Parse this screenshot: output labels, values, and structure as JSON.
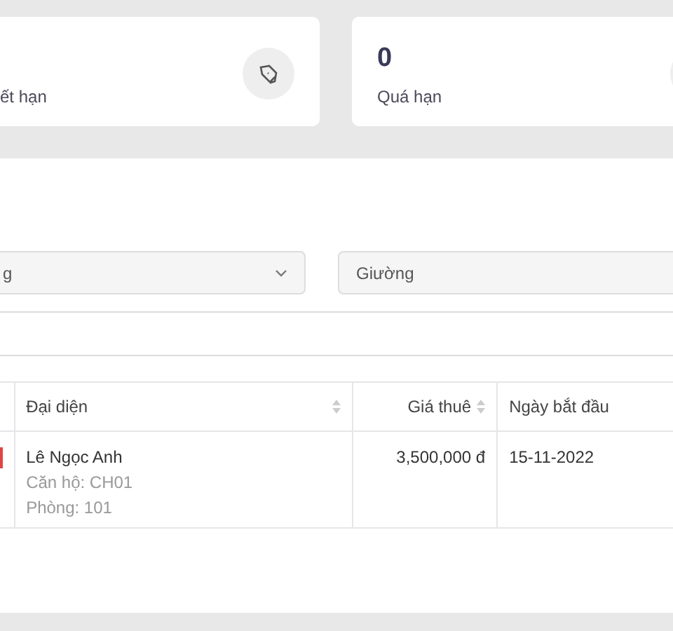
{
  "stats": [
    {
      "label": "ết hạn"
    },
    {
      "value": "0",
      "label": "Quá hạn"
    }
  ],
  "filters": [
    {
      "kind": "select",
      "value": "g"
    },
    {
      "kind": "input",
      "placeholder": "Giường"
    }
  ],
  "table": {
    "columns": [
      {
        "label": "Đại diện",
        "sortable": true
      },
      {
        "label": "Giá thuê",
        "sortable": true
      },
      {
        "label": "Ngày bắt đầu",
        "sortable": false
      }
    ],
    "rows": [
      {
        "representative": "Lê Ngọc Anh",
        "apartment": "Căn hộ: CH01",
        "room": "Phòng: 101",
        "rent": "3,500,000 đ",
        "start": "15-11-2022"
      }
    ]
  }
}
